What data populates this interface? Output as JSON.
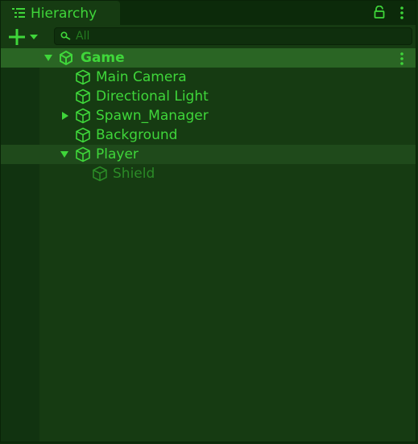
{
  "tab": {
    "title": "Hierarchy"
  },
  "toolbar": {
    "search_placeholder": "All"
  },
  "scene": {
    "name": "Game"
  },
  "objects": [
    {
      "name": "Main Camera"
    },
    {
      "name": "Directional Light"
    },
    {
      "name": "Spawn_Manager"
    },
    {
      "name": "Background"
    },
    {
      "name": "Player"
    },
    {
      "name": "Shield"
    }
  ],
  "icons": {
    "tab": "hierarchy-list-icon",
    "lock": "lock-icon",
    "menu": "kebab-menu-icon",
    "add": "plus-icon",
    "dropdown": "caret-down-icon",
    "search": "search-icon",
    "scene": "unity-logo-icon",
    "gameobject": "cube-icon"
  },
  "colors": {
    "text": "#3fd63a",
    "text_dim": "#2b8a27",
    "panel": "#163b12",
    "scene_row": "#2a6524",
    "hover_row": "#1f4a1b"
  }
}
